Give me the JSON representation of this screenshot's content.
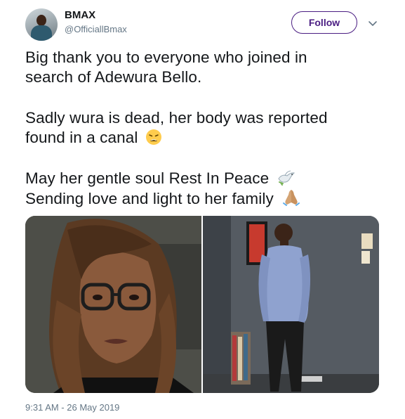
{
  "user": {
    "name": "BMAX",
    "handle": "@OfficiallBmax"
  },
  "actions": {
    "follow_label": "Follow"
  },
  "tweet": {
    "lines": [
      "Big thank you to everyone who joined in",
      "search of Adewura Bello.",
      "Sadly wura is dead, her body was reported",
      "found in a canal",
      "May her gentle soul Rest In Peace",
      "Sending love and light to her family"
    ],
    "emojis": [
      "weary-face-icon",
      "dove-icon",
      "folded-hands-icon"
    ],
    "timestamp": "9:31 AM - 26 May 2019"
  },
  "colors": {
    "accent": "#4a1d82",
    "text": "#14171a",
    "secondary_text": "#657786"
  }
}
